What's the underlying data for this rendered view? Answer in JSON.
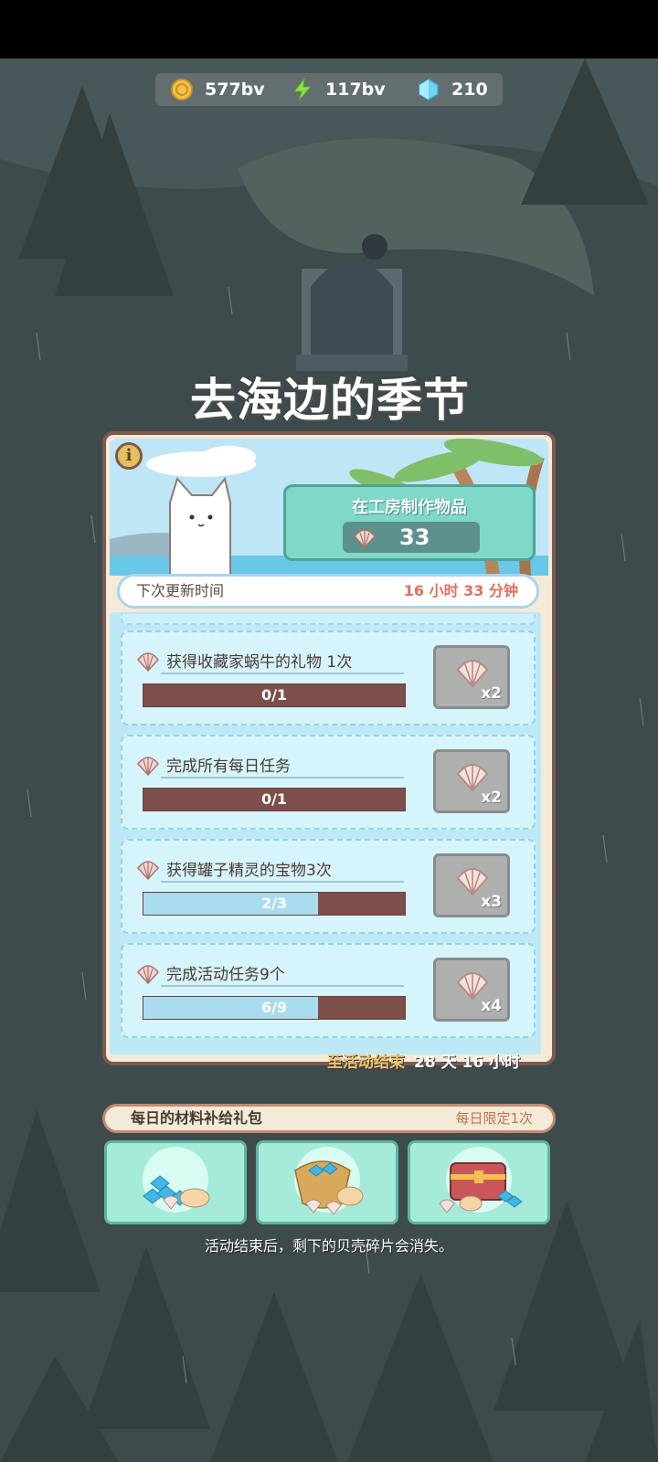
{
  "resources": [
    {
      "icon": "coin-icon",
      "value": "577bv"
    },
    {
      "icon": "lightning-icon",
      "value": "117bv"
    },
    {
      "icon": "gem-icon",
      "value": "210"
    }
  ],
  "event": {
    "title": "去海边的季节",
    "info_button": "i",
    "craft": {
      "label": "在工房制作物品",
      "shell_count": "33"
    },
    "next_update": {
      "label": "下次更新时间",
      "value": "16 小时 33 分钟"
    }
  },
  "tasks": [
    {
      "label": "获得收藏家蜗牛的礼物 1次",
      "progress_text": "0/1",
      "progress": 0.0,
      "reward_qty": "x2"
    },
    {
      "label": "完成所有每日任务",
      "progress_text": "0/1",
      "progress": 0.0,
      "reward_qty": "x2"
    },
    {
      "label": "获得罐子精灵的宝物3次",
      "progress_text": "2/3",
      "progress": 0.667,
      "reward_qty": "x3"
    },
    {
      "label": "完成活动任务9个",
      "progress_text": "6/9",
      "progress": 0.667,
      "reward_qty": "x4"
    }
  ],
  "event_end": {
    "label": "至活动结束",
    "value": "28 天 16 小时"
  },
  "daily_pack": {
    "title": "每日的材料补给礼包",
    "limit": "每日限定1次"
  },
  "packs": [
    {
      "name": "gems-and-shells-pack"
    },
    {
      "name": "sack-of-gems-pack"
    },
    {
      "name": "treasure-chest-pack"
    }
  ],
  "footer_note": "活动结束后，剩下的贝壳碎片会消失。",
  "colors": {
    "panel_border": "#7d5a4e",
    "list_bg": "#bde9f7",
    "progress_empty": "#7d4e4a",
    "progress_fill": "#a8dcee",
    "accent_red": "#e0705a"
  }
}
